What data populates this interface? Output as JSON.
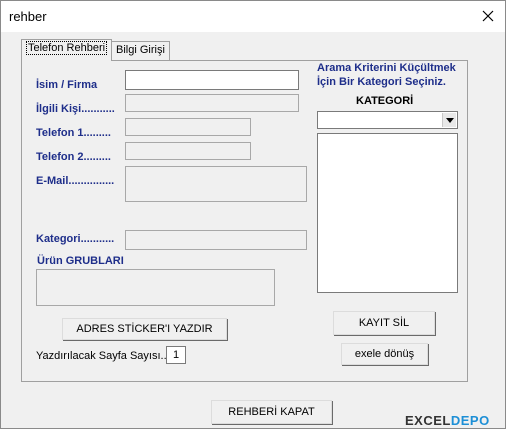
{
  "window": {
    "title": "rehber"
  },
  "tabs": [
    {
      "label": "Telefon Rehberi",
      "active": true
    },
    {
      "label": "Bilgi Girişi",
      "active": false
    }
  ],
  "form": {
    "name_label": "İsim / Firma",
    "contact_label": "İlgili Kişi...........",
    "phone1_label": "Telefon 1.........",
    "phone2_label": "Telefon 2.........",
    "email_label": "E-Mail...............",
    "category_label": "Kategori...........",
    "product_groups_label": "Ürün GRUBLARI",
    "name_value": "",
    "contact_value": "",
    "phone1_value": "",
    "phone2_value": "",
    "email_value": "",
    "category_value": "",
    "product_groups_value": ""
  },
  "sidebar": {
    "hint_line1": "Arama Kriterini Küçültmek",
    "hint_line2": "İçin Bir Kategori Seçiniz.",
    "category_heading": "KATEGORİ",
    "category_selected": ""
  },
  "buttons": {
    "print_sticker": "ADRES STİCKER'I  YAZDIR",
    "delete_record": "KAYIT SİL",
    "back_to_excel": "exele dönüş",
    "close_directory": "REHBERİ KAPAT"
  },
  "print": {
    "pages_label": "Yazdırılacak Sayfa Sayısı...",
    "pages_value": "1"
  },
  "watermark": {
    "part1": "EXCEL",
    "part2": "DEPO"
  },
  "colors": {
    "label_blue": "#1e2e8a",
    "accent": "#1d8fd6"
  }
}
